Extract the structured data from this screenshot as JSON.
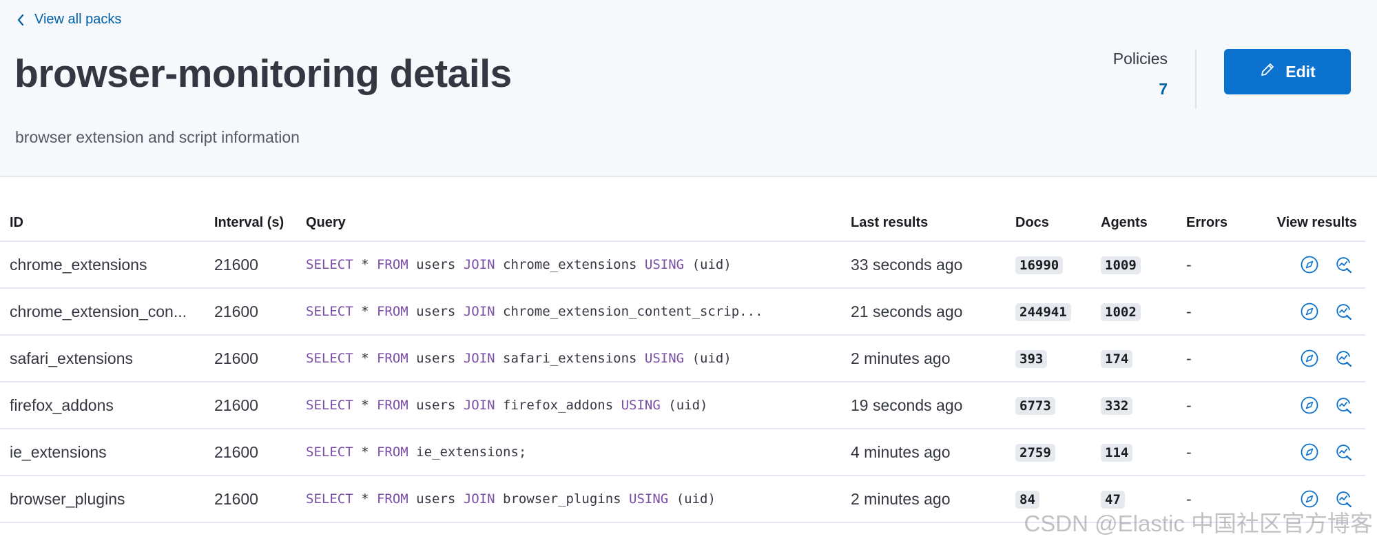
{
  "header": {
    "back_label": "View all packs",
    "title": "browser-monitoring details",
    "description": "browser extension and script information",
    "policies_label": "Policies",
    "policies_count": "7",
    "edit_label": "Edit"
  },
  "table": {
    "columns": [
      "ID",
      "Interval (s)",
      "Query",
      "Last results",
      "Docs",
      "Agents",
      "Errors",
      "View results"
    ],
    "rows": [
      {
        "id": "chrome_extensions",
        "interval": "21600",
        "query": [
          "SELECT",
          " * ",
          "FROM",
          " users ",
          "JOIN",
          " chrome_extensions ",
          "USING",
          " (uid)"
        ],
        "last": "33 seconds ago",
        "docs": "16990",
        "agents": "1009",
        "errors": "-"
      },
      {
        "id": "chrome_extension_con...",
        "interval": "21600",
        "query": [
          "SELECT",
          " * ",
          "FROM",
          " users ",
          "JOIN",
          " chrome_extension_content_scrip...",
          "",
          ""
        ],
        "last": "21 seconds ago",
        "docs": "244941",
        "agents": "1002",
        "errors": "-"
      },
      {
        "id": "safari_extensions",
        "interval": "21600",
        "query": [
          "SELECT",
          " * ",
          "FROM",
          " users ",
          "JOIN",
          " safari_extensions ",
          "USING",
          " (uid)"
        ],
        "last": "2 minutes ago",
        "docs": "393",
        "agents": "174",
        "errors": "-"
      },
      {
        "id": "firefox_addons",
        "interval": "21600",
        "query": [
          "SELECT",
          " * ",
          "FROM",
          " users ",
          "JOIN",
          " firefox_addons ",
          "USING",
          " (uid)"
        ],
        "last": "19 seconds ago",
        "docs": "6773",
        "agents": "332",
        "errors": "-"
      },
      {
        "id": "ie_extensions",
        "interval": "21600",
        "query": [
          "SELECT",
          " * ",
          "FROM",
          " ie_extensions;",
          "",
          "",
          "",
          ""
        ],
        "last": "4 minutes ago",
        "docs": "2759",
        "agents": "114",
        "errors": "-"
      },
      {
        "id": "browser_plugins",
        "interval": "21600",
        "query": [
          "SELECT",
          " * ",
          "FROM",
          " users ",
          "JOIN",
          " browser_plugins ",
          "USING",
          " (uid)"
        ],
        "last": "2 minutes ago",
        "docs": "84",
        "agents": "47",
        "errors": "-"
      }
    ]
  },
  "watermark": "CSDN @Elastic 中国社区官方博客",
  "colors": {
    "link": "#0061a6",
    "button": "#0b72d0",
    "keyword": "#7b4ea6",
    "icon": "#0b72d0"
  },
  "icons": {
    "back": "chevron-left-icon",
    "edit": "pencil-icon",
    "discover": "compass-icon",
    "lens": "lens-icon"
  }
}
